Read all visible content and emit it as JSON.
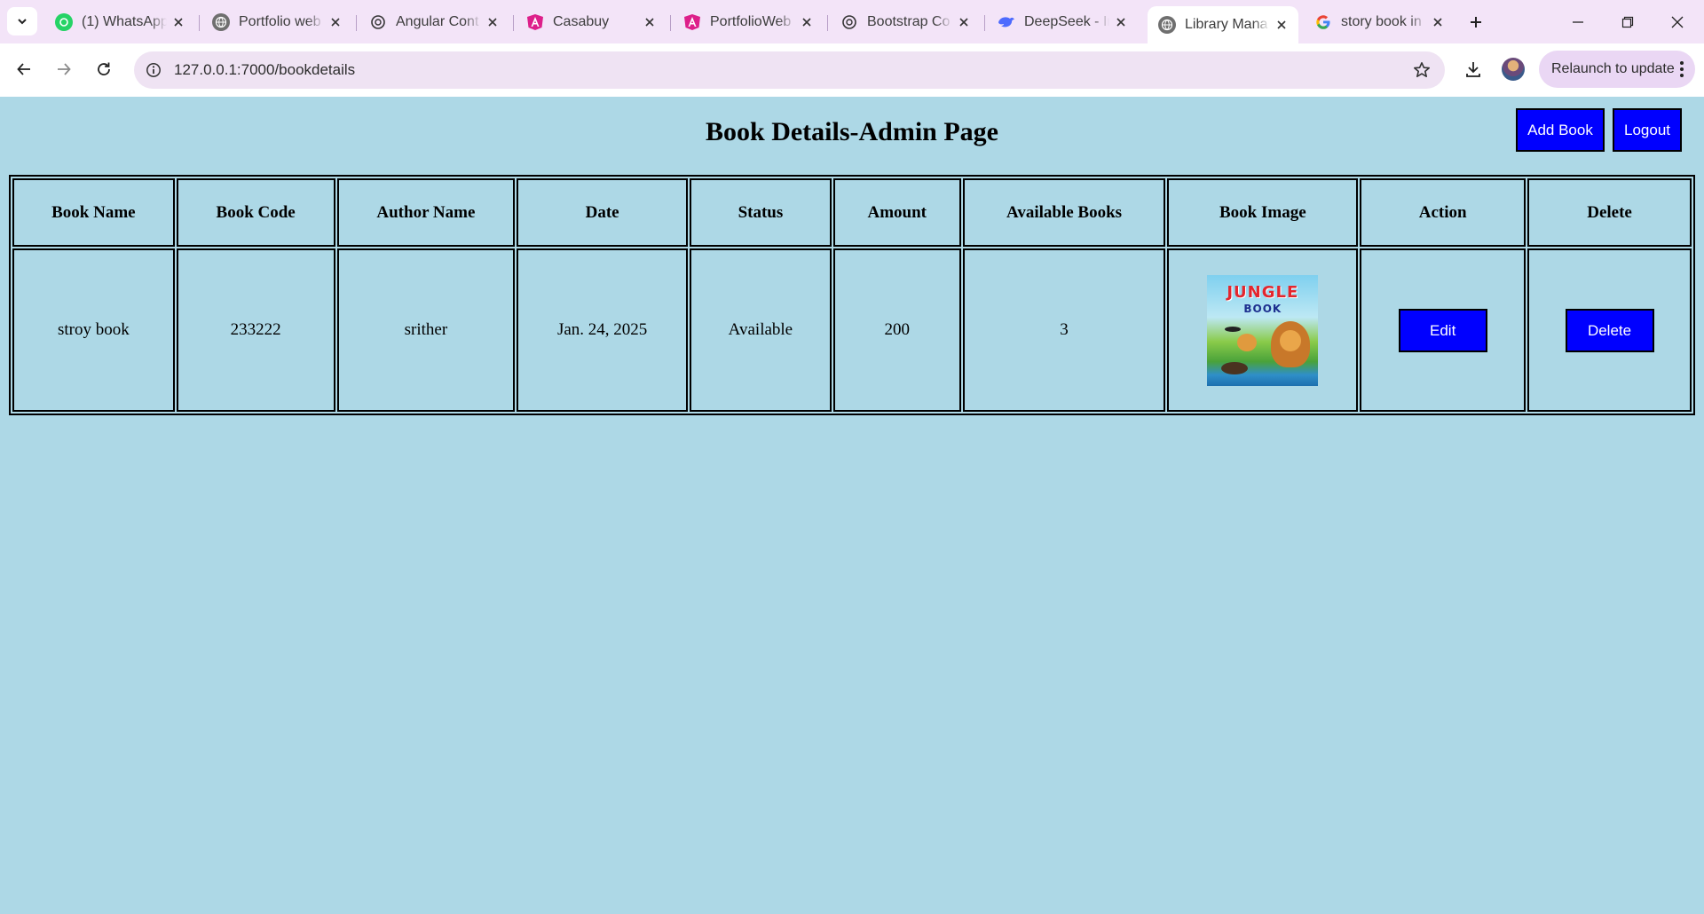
{
  "browser": {
    "tabs": [
      {
        "label": "(1) WhatsApp",
        "icon": "whatsapp-icon"
      },
      {
        "label": "Portfolio web",
        "icon": "globe-icon"
      },
      {
        "label": "Angular Cont",
        "icon": "openai-icon"
      },
      {
        "label": "Casabuy",
        "icon": "angular-icon"
      },
      {
        "label": "PortfolioWeb",
        "icon": "angular-icon"
      },
      {
        "label": "Bootstrap Co",
        "icon": "openai-icon"
      },
      {
        "label": "DeepSeek - In",
        "icon": "deepseek-icon"
      },
      {
        "label": "Library Mana",
        "icon": "globe-icon",
        "active": true
      },
      {
        "label": "story book in",
        "icon": "google-icon"
      }
    ],
    "url": "127.0.0.1:7000/bookdetails",
    "relaunch_label": "Relaunch to update"
  },
  "page": {
    "title": "Book Details-Admin Page",
    "add_book_label": "Add Book",
    "logout_label": "Logout"
  },
  "table": {
    "headers": [
      "Book Name",
      "Book Code",
      "Author Name",
      "Date",
      "Status",
      "Amount",
      "Available Books",
      "Book Image",
      "Action",
      "Delete"
    ],
    "rows": [
      {
        "book_name": "stroy book",
        "book_code": "233222",
        "author_name": "srither",
        "date": "Jan. 24, 2025",
        "status": "Available",
        "amount": "200",
        "available_books": "3",
        "image": {
          "title": "JUNGLE",
          "subtitle": "BOOK"
        },
        "edit_label": "Edit",
        "delete_label": "Delete"
      }
    ]
  },
  "colors": {
    "page_background": "#add8e6",
    "button_background": "#0000ff",
    "button_text": "#ffffff",
    "browser_frame": "#f3e4f8"
  }
}
